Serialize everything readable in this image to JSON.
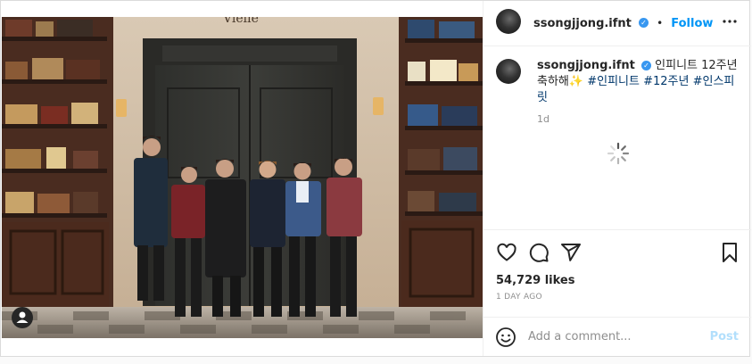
{
  "post": {
    "username": "ssongjjong.ifnt",
    "verified_glyph": "✓",
    "dot": "•",
    "follow_label": "Follow",
    "more_label": "•••",
    "caption_prefix": "인피니트 12주년 축하해",
    "caption_emoji": "✨",
    "hashtags": [
      "#인피니트",
      "#12주년",
      "#인스피릿"
    ],
    "time_short": "1d",
    "likes": "54,729 likes",
    "time_ago": "1 DAY AGO",
    "comment_placeholder": "Add a comment...",
    "post_label": "Post",
    "photo_sign": "Vielle"
  },
  "colors": {
    "accent": "#0095f6",
    "hashtag": "#00376b",
    "muted": "#8e8e8e"
  },
  "icons": [
    "more-icon",
    "heart-icon",
    "comment-icon",
    "share-icon",
    "bookmark-icon",
    "emoji-icon",
    "spinner-icon",
    "user-tag-icon"
  ]
}
